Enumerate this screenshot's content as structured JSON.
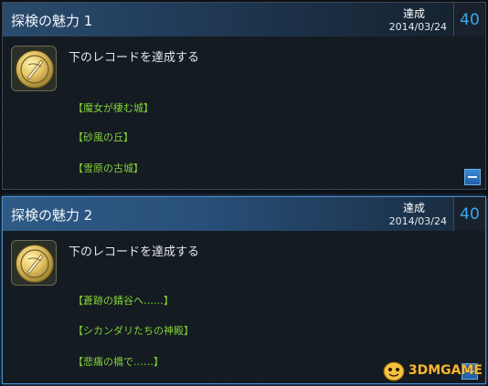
{
  "achievements": [
    {
      "title": "探検の魅力 1",
      "status": "達成",
      "date": "2014/03/24",
      "points": "40",
      "description": "下のレコードを達成する",
      "records": [
        "【魔女が棲む城】",
        "【砂風の丘】",
        "【雪原の古城】"
      ]
    },
    {
      "title": "探検の魅力 2",
      "status": "達成",
      "date": "2014/03/24",
      "points": "40",
      "description": "下のレコードを達成する",
      "records": [
        "【蒼跡の錆谷へ……】",
        "【シカンダリたちの神殿】",
        "【悲痛の橋で……】"
      ]
    }
  ],
  "watermark": {
    "text": "3DMGAME"
  },
  "colors": {
    "accent": "#3ba6ee",
    "record_text": "#84d23a",
    "selected_border": "#4a8fd0"
  }
}
